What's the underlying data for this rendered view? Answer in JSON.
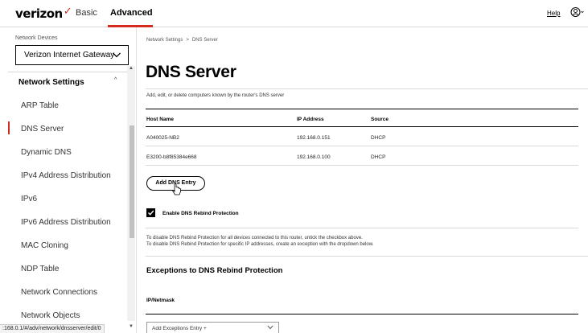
{
  "header": {
    "logo_text": "verizon",
    "tabs": [
      {
        "label": "Basic"
      },
      {
        "label": "Advanced"
      }
    ],
    "help_label": "Help",
    "user_icon": "user-circle-icon",
    "accent_color": "#d52b1e"
  },
  "sidebar": {
    "device_label": "Network Devices",
    "device_select_value": "Verizon Internet Gateway",
    "section_title": "Network Settings",
    "items": [
      {
        "label": "ARP Table"
      },
      {
        "label": "DNS Server"
      },
      {
        "label": "Dynamic DNS"
      },
      {
        "label": "IPv4 Address Distribution"
      },
      {
        "label": "IPv6"
      },
      {
        "label": "IPv6 Address Distribution"
      },
      {
        "label": "MAC Cloning"
      },
      {
        "label": "NDP Table"
      },
      {
        "label": "Network Connections"
      },
      {
        "label": "Network Objects"
      }
    ],
    "active_item": "DNS Server"
  },
  "status_url": ":168.0.1/#/adv/network/dnsserver/edit/0",
  "main": {
    "breadcrumb": [
      "Network Settings",
      "DNS Server"
    ],
    "breadcrumb_sep": ">",
    "title": "DNS Server",
    "description": "Add, edit, or delete computers known by the router's DNS server",
    "table": {
      "headers": [
        "Host Name",
        "IP Address",
        "Source"
      ],
      "rows": [
        [
          "A040025-NB2",
          "192.168.0.151",
          "DHCP"
        ],
        [
          "E3200-b8f85384e668",
          "192.168.0.100",
          "DHCP"
        ]
      ]
    },
    "add_button_label": "Add DNS Entry",
    "rebind_checkbox_label": "Enable DNS Rebind Protection",
    "rebind_checked": true,
    "info_lines": [
      "To disable DNS Rebind Protection for all devices connected to this router, untick the checkbox above.",
      "To disable DNS Rebind Protection for specific IP addresses, create an exception with the dropdown below."
    ],
    "exceptions_title": "Exceptions to DNS Rebind Protection",
    "ip_netmask_label": "IP/Netmask",
    "exception_select_value": "Add Exceptions Entry +"
  }
}
